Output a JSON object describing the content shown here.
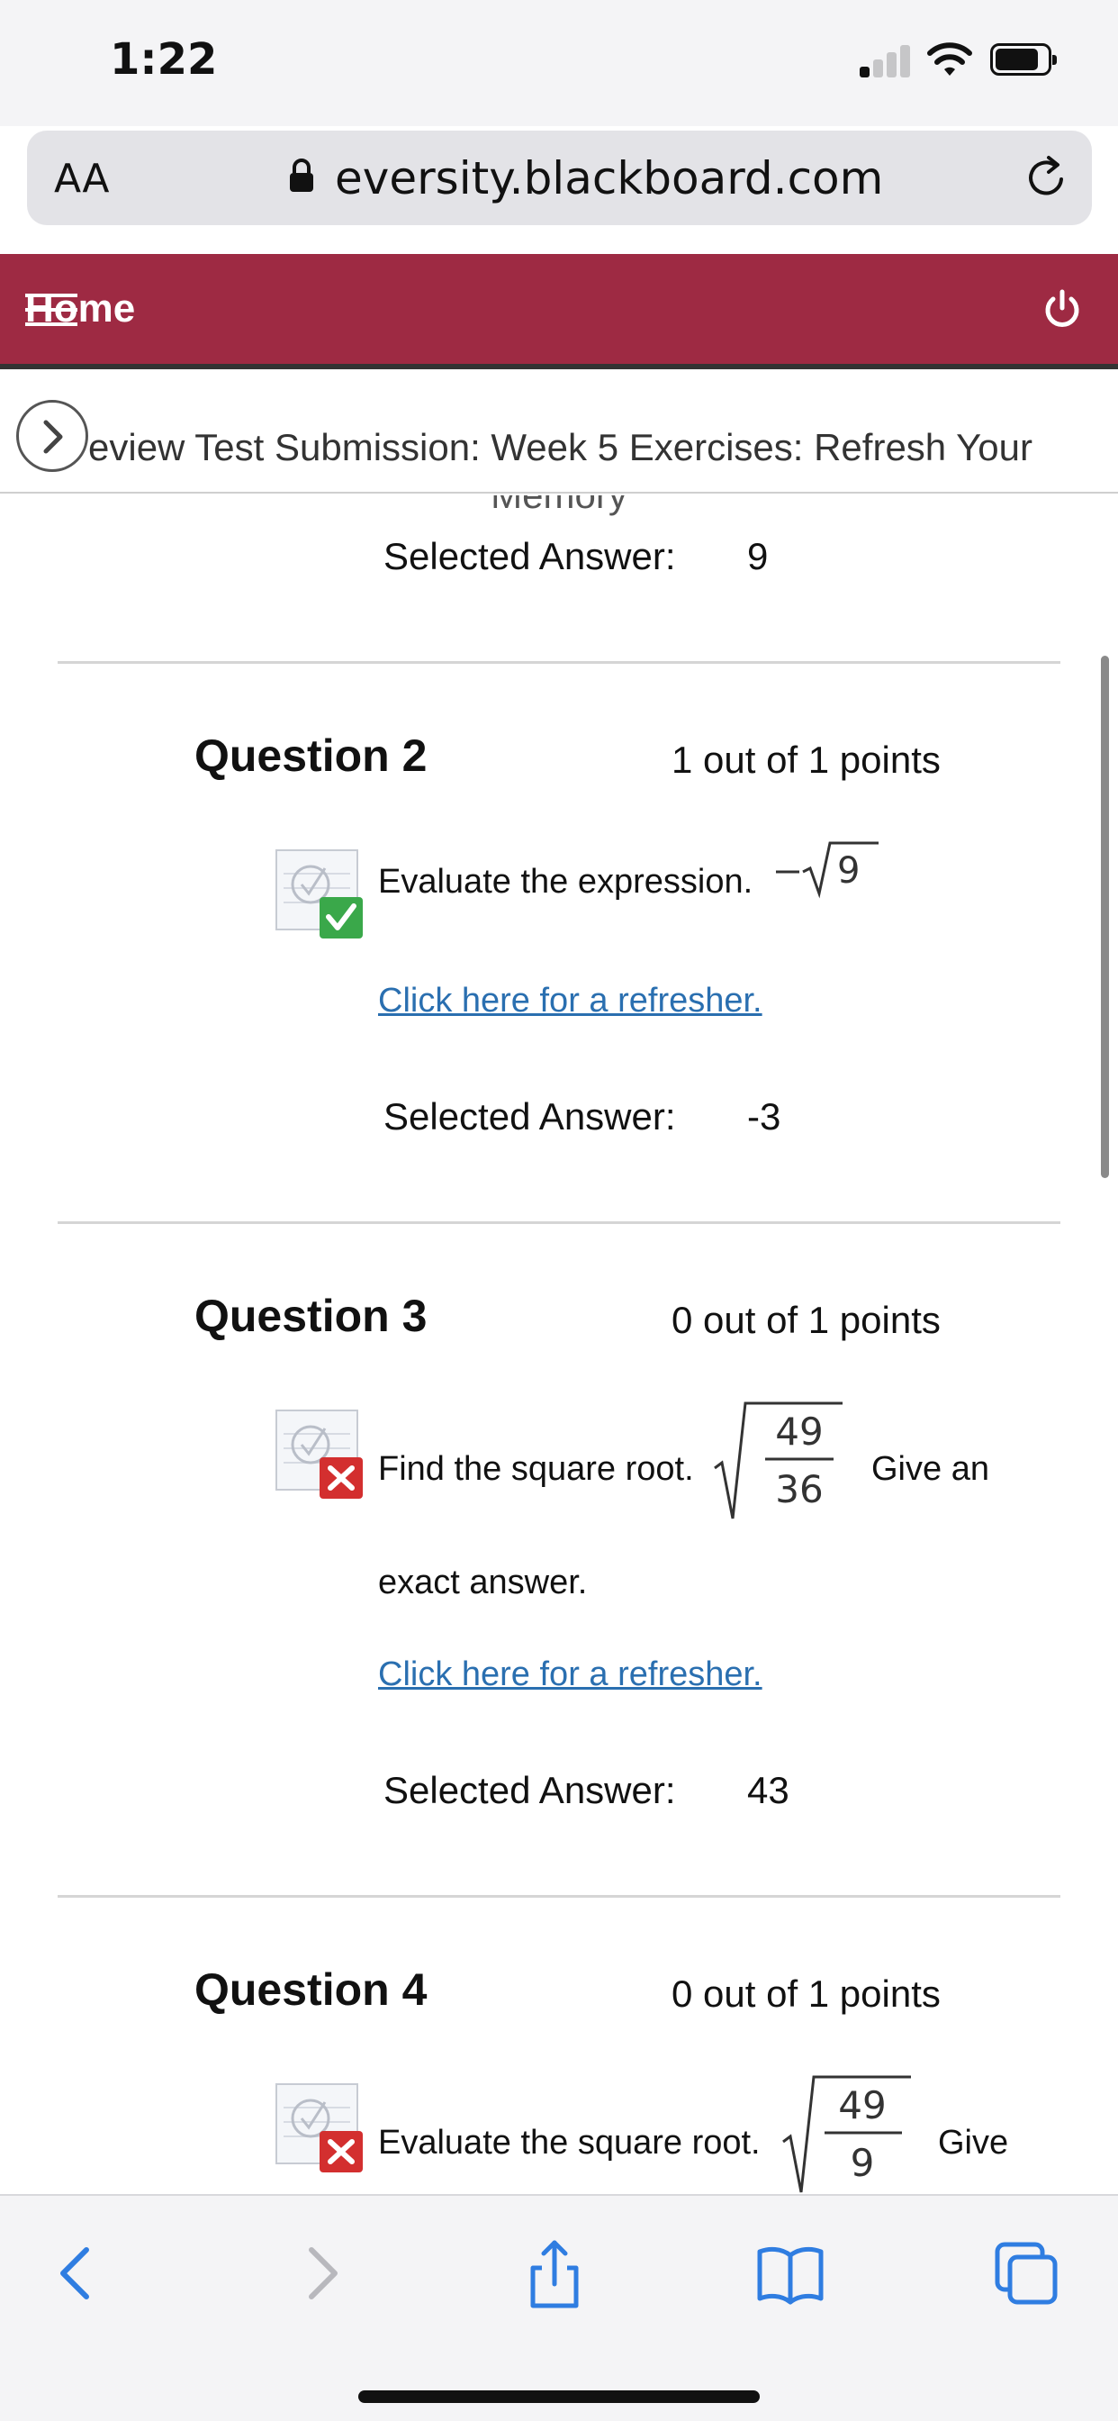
{
  "status_bar": {
    "time": "1:22"
  },
  "browser": {
    "text_size_label": "AA",
    "url": "eversity.blackboard.com"
  },
  "header": {
    "home_label": "Home"
  },
  "breadcrumb": {
    "title_line1": "eview Test Submission: Week 5 Exercises: Refresh Your",
    "title_line2": "Memory"
  },
  "question_1_tail": {
    "selected_answer_label": "Selected Answer:",
    "selected_answer": "9"
  },
  "questions": [
    {
      "title": "Question 2",
      "points": "1 out of 1 points",
      "status": "correct",
      "prompt": "Evaluate the expression.",
      "expression": "−√9",
      "refresher_link": "Click here for a refresher.",
      "selected_answer_label": "Selected Answer:",
      "selected_answer": "-3"
    },
    {
      "title": "Question 3",
      "points": "0 out of 1 points",
      "status": "incorrect",
      "prompt": "Find the square root.",
      "fraction_numerator": "49",
      "fraction_denominator": "36",
      "prompt_suffix": "Give an",
      "prompt_line2": "exact answer.",
      "refresher_link": "Click here for a refresher.",
      "selected_answer_label": "Selected Answer:",
      "selected_answer": "43"
    },
    {
      "title": "Question 4",
      "points": "0 out of 1 points",
      "status": "incorrect",
      "prompt": "Evaluate the square root.",
      "fraction_numerator": "49",
      "fraction_denominator": "9",
      "prompt_suffix": "Give"
    }
  ],
  "colors": {
    "header_bg": "#9e2a43",
    "link": "#2a6fb0",
    "correct": "#3aa84a",
    "incorrect": "#d32f2f",
    "toolbar_icon": "#2f7de1"
  },
  "toolbar_icons": [
    "back-icon",
    "forward-icon",
    "share-icon",
    "bookmarks-icon",
    "tabs-icon"
  ]
}
